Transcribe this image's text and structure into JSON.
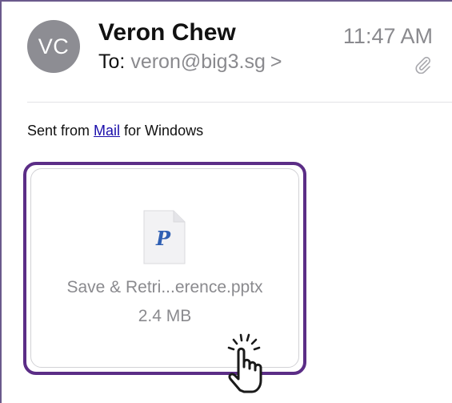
{
  "header": {
    "avatar_initials": "VC",
    "sender_name": "Veron Chew",
    "to_label": "To:",
    "to_address": "veron@big3.sg",
    "to_chevron": ">",
    "time": "11:47 AM",
    "attachment_indicator_icon": "paperclip-icon"
  },
  "message": {
    "text_before": "Sent from ",
    "link_text": "Mail",
    "text_after": " for Windows"
  },
  "attachment": {
    "icon": "powerpoint-file-icon",
    "icon_letter": "P",
    "file_name": "Save & Retri...erence.pptx",
    "file_size": "2.4 MB"
  },
  "overlay": {
    "pointer_icon": "hand-pointer-icon"
  },
  "colors": {
    "highlight": "#5b2d86",
    "avatar_bg": "#8d8d93",
    "secondary_text": "#8a8a8e",
    "link": "#1a0dab",
    "ppt_letter": "#2f5fb3"
  }
}
